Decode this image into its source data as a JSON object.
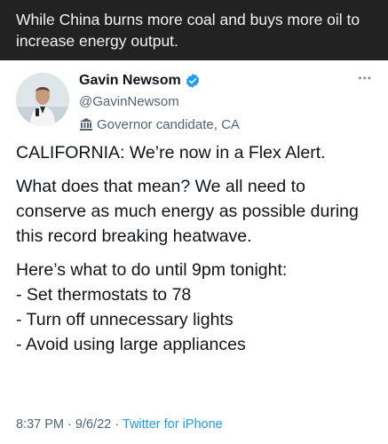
{
  "caption": "While China burns more coal and buys more oil to increase energy output.",
  "tweet": {
    "author": {
      "display_name": "Gavin Newsom",
      "handle": "@GavinNewsom",
      "label": "Governor candidate, CA",
      "verified_color": "#1d9bf0"
    },
    "paragraphs": [
      "CALIFORNIA: We’re now in a Flex Alert.",
      "What does that mean? We all need to conserve as much energy as possible during this record breaking heatwave.",
      "Here’s what to do until 9pm tonight:\n- Set thermostats to 78\n- Turn off unnecessary lights\n- Avoid using large appliances"
    ],
    "time": "8:37 PM",
    "separator": "·",
    "date": "9/6/22",
    "source": "Twitter for iPhone"
  }
}
